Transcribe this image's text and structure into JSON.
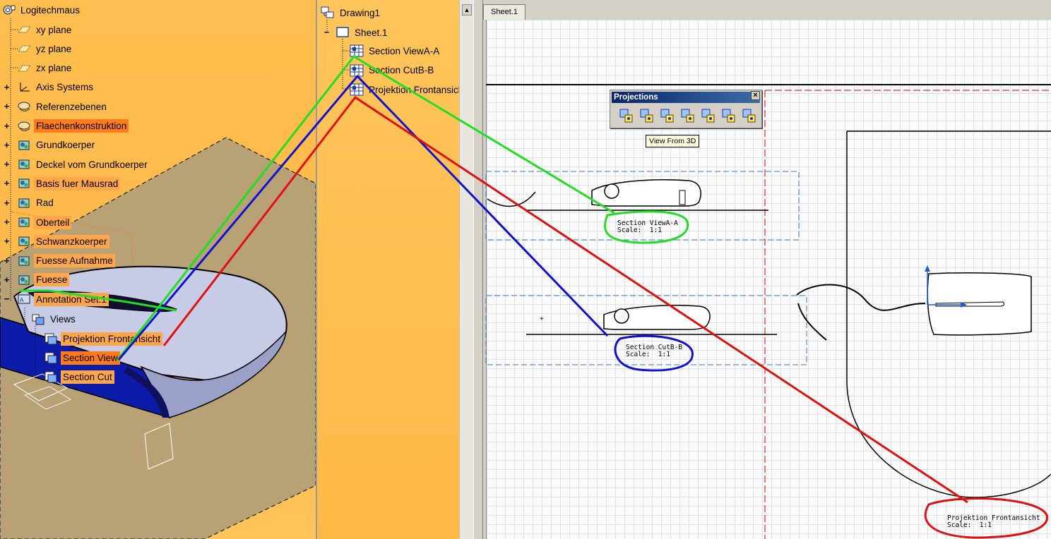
{
  "model_tree": {
    "root": "Logitechmaus",
    "items": [
      {
        "label": "xy plane",
        "icon": "plane-icon",
        "expander": false,
        "style": "plain"
      },
      {
        "label": "yz plane",
        "icon": "plane-icon",
        "expander": false,
        "style": "plain"
      },
      {
        "label": "zx plane",
        "icon": "plane-icon",
        "expander": false,
        "style": "plain"
      },
      {
        "label": "Axis Systems",
        "icon": "axis-icon",
        "expander": true,
        "style": "plain"
      },
      {
        "label": "Referenzebenen",
        "icon": "geoset-icon",
        "expander": true,
        "style": "plain"
      },
      {
        "label": "Flaechenkonstruktion",
        "icon": "geoset-icon",
        "expander": true,
        "style": "selected"
      },
      {
        "label": "Grundkoerper",
        "icon": "body-icon",
        "expander": true,
        "style": "plain"
      },
      {
        "label": "Deckel vom Grundkoerper",
        "icon": "body-icon",
        "expander": true,
        "style": "plain"
      },
      {
        "label": "Basis fuer Mausrad",
        "icon": "body-icon",
        "expander": true,
        "style": "highlight"
      },
      {
        "label": "Rad",
        "icon": "body-icon",
        "expander": true,
        "style": "plain"
      },
      {
        "label": "Oberteil",
        "icon": "body-icon",
        "expander": true,
        "style": "highlight"
      },
      {
        "label": "Schwanzkoerper",
        "icon": "body-icon",
        "expander": true,
        "style": "highlight"
      },
      {
        "label": "Fuesse Aufnahme",
        "icon": "body-icon",
        "expander": true,
        "style": "highlight"
      },
      {
        "label": "Fuesse",
        "icon": "body-icon",
        "expander": true,
        "style": "highlight"
      },
      {
        "label": "Annotation Set.1",
        "icon": "annotation-set-icon",
        "expander": "minus",
        "style": "highlight"
      }
    ],
    "views_node": "Views",
    "views": [
      {
        "label": "Projektion Frontansicht",
        "style": "highlight"
      },
      {
        "label": "Section View",
        "style": "selected"
      },
      {
        "label": "Section Cut",
        "style": "highlight"
      }
    ]
  },
  "drawing_tree": {
    "root": "Drawing1",
    "sheet": "Sheet.1",
    "views": [
      "Section ViewA-A",
      "Section CutB-B",
      "Projektion Frontansicht"
    ]
  },
  "sheet_tab": "Sheet.1",
  "toolbar": {
    "title": "Projections",
    "close": "×",
    "tooltip": "View From 3D",
    "buttons": [
      "front-view-icon",
      "unfolded-view-icon",
      "view-from-3d-icon",
      "projection-view-icon",
      "auxiliary-view-icon",
      "isometric-view-icon",
      "advanced-front-view-icon"
    ]
  },
  "captions": {
    "section_view": "Section ViewA-A\nScale:  1:1",
    "section_cut": "Section CutB-B\nScale:  1:1",
    "front_view": "Projektion Frontansicht\nScale:  1:1"
  },
  "colors": {
    "green": "#22dd22",
    "blue": "#1010d0",
    "red": "#e01010",
    "panel_orange": "#ffb84a",
    "selection": "#ff7a1a"
  }
}
